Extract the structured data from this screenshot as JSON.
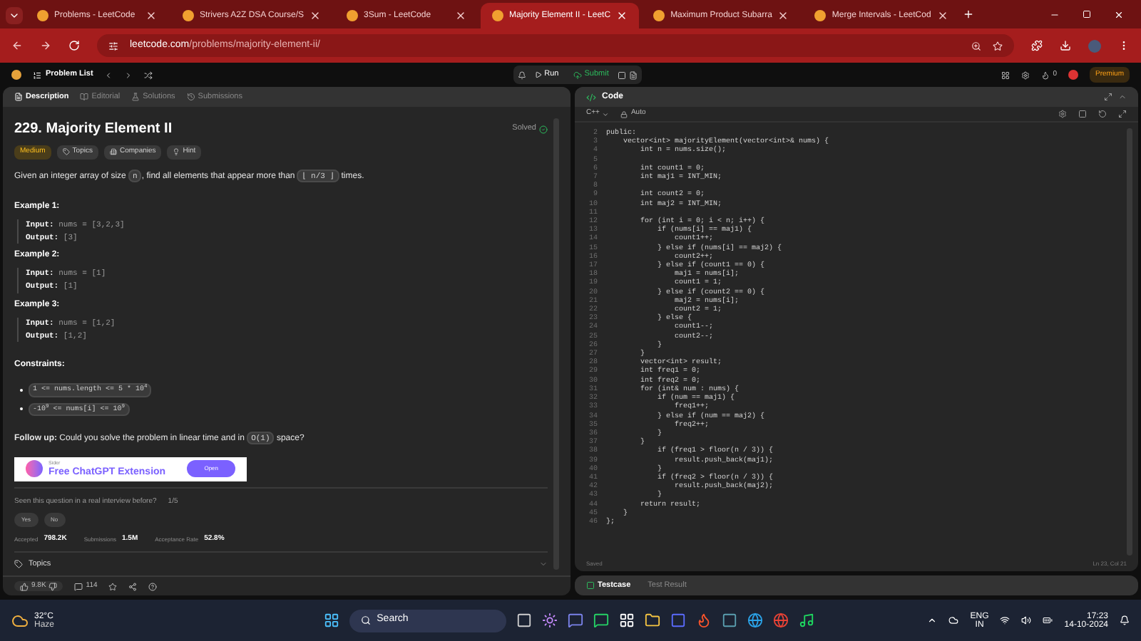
{
  "browser": {
    "tabs": [
      {
        "label": "Problems - LeetCode",
        "selected": false
      },
      {
        "label": "Strivers A2Z DSA Course/S",
        "selected": false
      },
      {
        "label": "3Sum - LeetCode",
        "selected": false
      },
      {
        "label": "Majority Element II - LeetC",
        "selected": true
      },
      {
        "label": "Maximum Product Subarra",
        "selected": false
      },
      {
        "label": "Merge Intervals - LeetCod",
        "selected": false
      }
    ],
    "url_host": "leetcode.com",
    "url_path": "/problems/majority-element-ii/"
  },
  "nav": {
    "problem_list": "Problem List",
    "run": "Run",
    "submit": "Submit",
    "streak": "0",
    "premium": "Premium"
  },
  "left_tabs": [
    {
      "label": "Description",
      "selected": true
    },
    {
      "label": "Editorial",
      "selected": false
    },
    {
      "label": "Solutions",
      "selected": false
    },
    {
      "label": "Submissions",
      "selected": false
    }
  ],
  "problem": {
    "title": "229. Majority Element II",
    "status": "Solved",
    "difficulty": "Medium",
    "tags": [
      "Topics",
      "Companies",
      "Hint"
    ],
    "description": [
      {
        "kind": "text",
        "text": "Given an integer array of size "
      },
      {
        "kind": "code",
        "text": "n"
      },
      {
        "kind": "text",
        "text": ", find all elements that appear more than "
      },
      {
        "kind": "code",
        "text": "⌊ n/3 ⌋"
      },
      {
        "kind": "text",
        "text": " times."
      }
    ],
    "examples": [
      {
        "title": "Example 1:",
        "input_label": "Input:",
        "input": "nums = [3,2,3]",
        "output_label": "Output:",
        "output": "[3]"
      },
      {
        "title": "Example 2:",
        "input_label": "Input:",
        "input": "nums = [1]",
        "output_label": "Output:",
        "output": "[1]"
      },
      {
        "title": "Example 3:",
        "input_label": "Input:",
        "input": "nums = [1,2]",
        "output_label": "Output:",
        "output": "[1,2]"
      }
    ],
    "constraints_title": "Constraints:",
    "constraints": [
      "1 <= nums.length <= 5 * 10$^{4}$",
      "-10$^{9}$ <= nums[i] <= 10$^{9}$"
    ],
    "follow_up": [
      {
        "kind": "bold",
        "text": "Follow up:"
      },
      {
        "kind": "text",
        "text": " Could you solve the problem in linear time and in "
      },
      {
        "kind": "code",
        "text": "O(1)"
      },
      {
        "kind": "text",
        "text": " space?"
      }
    ]
  },
  "ad": {
    "brand": "Sider",
    "headline": "Free ChatGPT Extension",
    "button": "Open"
  },
  "survey": {
    "question": "Seen this question in a real interview before?",
    "count": "1/5",
    "options": [
      "Yes",
      "No"
    ]
  },
  "stats": [
    {
      "label": "Accepted",
      "value": "798.2K"
    },
    {
      "label": "Submissions",
      "value": "1.5M"
    },
    {
      "label": "Acceptance Rate",
      "value": "52.8%"
    }
  ],
  "topics": "Topics",
  "footer": {
    "likes": "9.8K",
    "comments": "114"
  },
  "code": {
    "title": "Code",
    "language": "C++",
    "mode": "Auto",
    "lines": [
      {
        "n": "2",
        "t": "public:"
      },
      {
        "n": "3",
        "t": "    vector<int> majorityElement(vector<int>& nums) {"
      },
      {
        "n": "4",
        "t": "        int n = nums.size();"
      },
      {
        "n": "5"
      },
      {
        "n": "6",
        "t": "        int count1 = 0;"
      },
      {
        "n": "7",
        "t": "        int maj1 = INT_MIN;"
      },
      {
        "n": "8"
      },
      {
        "n": "9",
        "t": "        int count2 = 0;"
      },
      {
        "n": "10",
        "t": "        int maj2 = INT_MIN;"
      },
      {
        "n": "11"
      },
      {
        "n": "12",
        "t": "        for (int i = 0; i < n; i++) {"
      },
      {
        "n": "13",
        "t": "            if (nums[i] == maj1) {"
      },
      {
        "n": "14",
        "t": "                count1++;"
      },
      {
        "n": "15",
        "t": "            } else if (nums[i] == maj2) {"
      },
      {
        "n": "16",
        "t": "                count2++;"
      },
      {
        "n": "17",
        "t": "            } else if (count1 == 0) {"
      },
      {
        "n": "18",
        "t": "                maj1 = nums[i];"
      },
      {
        "n": "19",
        "t": "                count1 = 1;"
      },
      {
        "n": "20",
        "t": "            } else if (count2 == 0) {"
      },
      {
        "n": "21",
        "t": "                maj2 = nums[i];"
      },
      {
        "n": "22",
        "t": "                count2 = 1;"
      },
      {
        "n": "23",
        "t": "            } else {"
      },
      {
        "n": "24",
        "t": "                count1--;"
      },
      {
        "n": "25",
        "t": "                count2--;"
      },
      {
        "n": "26",
        "t": "            }"
      },
      {
        "n": "27",
        "t": "        }"
      },
      {
        "n": "28",
        "t": "        vector<int> result;"
      },
      {
        "n": "29",
        "t": "        int freq1 = 0;"
      },
      {
        "n": "30",
        "t": "        int freq2 = 0;"
      },
      {
        "n": "31",
        "t": "        for (int& num : nums) {"
      },
      {
        "n": "32",
        "t": "            if (num == maj1) {"
      },
      {
        "n": "33",
        "t": "                freq1++;"
      },
      {
        "n": "34",
        "t": "            } else if (num == maj2) {"
      },
      {
        "n": "35",
        "t": "                freq2++;"
      },
      {
        "n": "36",
        "t": "            }"
      },
      {
        "n": "37",
        "t": "        }"
      },
      {
        "n": "38",
        "t": "            if (freq1 > floor(n / 3)) {"
      },
      {
        "n": "39",
        "t": "                result.push_back(maj1);"
      },
      {
        "n": "40",
        "t": "            }"
      },
      {
        "n": "41",
        "t": "            if (freq2 > floor(n / 3)) {"
      },
      {
        "n": "42",
        "t": "                result.push_back(maj2);"
      },
      {
        "n": "43",
        "t": "            }"
      },
      {
        "n": "44",
        "t": "        return result;"
      },
      {
        "n": "45",
        "t": "    }"
      },
      {
        "n": "46",
        "t": "};"
      }
    ],
    "saved": "Saved",
    "position": "Ln 23, Col 21"
  },
  "bottom_tabs": [
    {
      "label": "Testcase",
      "selected": true
    },
    {
      "label": "Test Result",
      "selected": false
    }
  ],
  "taskbar": {
    "temperature": "32°C",
    "weather": "Haze",
    "search": "Search",
    "lang": "ENG",
    "region": "IN",
    "time": "17:23",
    "date": "14-10-2024"
  }
}
